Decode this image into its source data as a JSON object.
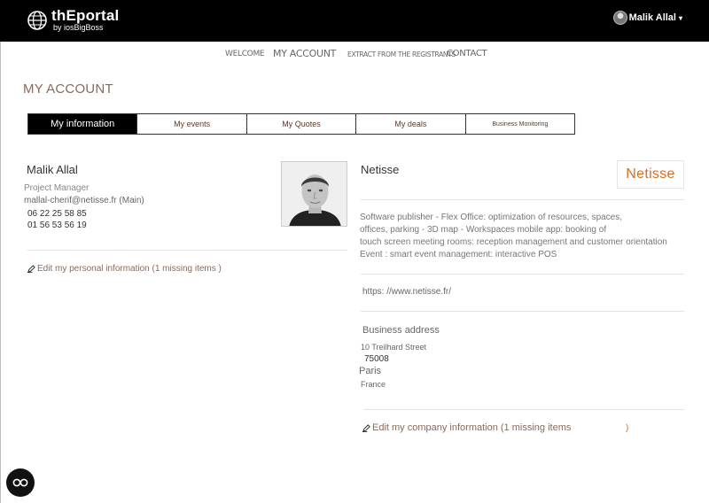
{
  "header": {
    "logo_title": "thEportal",
    "logo_subtitle": "by iosBigBoss",
    "user_name": "Malik Allal"
  },
  "nav": {
    "welcome": "WELCOME",
    "my_account": "MY ACCOUNT",
    "extract": "EXTRACT FROM THE REGISTRANTS",
    "contact": "CONTACT"
  },
  "page_title": "MY ACCOUNT",
  "tabs": [
    {
      "label": "My information",
      "active": true
    },
    {
      "label": "My events"
    },
    {
      "label": "My Quotes"
    },
    {
      "label": "My deals"
    },
    {
      "label": "Business Monitoring"
    }
  ],
  "person": {
    "name": "Malik Allal",
    "role": "Project Manager",
    "email": "mallal-cherif@netisse.fr (Main)",
    "phone1": "06 22 25 58 85",
    "phone2": "01 56 53 56 19",
    "edit_label": "Edit my personal information (1 missing items )"
  },
  "company": {
    "name": "Netisse",
    "logo_text": "Netisse",
    "description": [
      "Software publisher - Flex Office: optimization of resources, spaces,",
      "offices, parking - 3D map - Workspaces mobile app: booking of",
      "touch screen meeting rooms: reception management and customer orientation",
      "Event : smart event management: interactive POS"
    ],
    "url": "https: //www.netisse.fr/",
    "address_title": "Business address",
    "street": "10 Treilhard Street",
    "zip": "75008",
    "city": "Paris",
    "country": "France",
    "edit_label": "Edit my company information (1 missing items",
    "edit_tail": ")"
  },
  "colors": {
    "accent": "#e06a1a",
    "link": "#8a6a5a",
    "header_bg": "#000000"
  }
}
